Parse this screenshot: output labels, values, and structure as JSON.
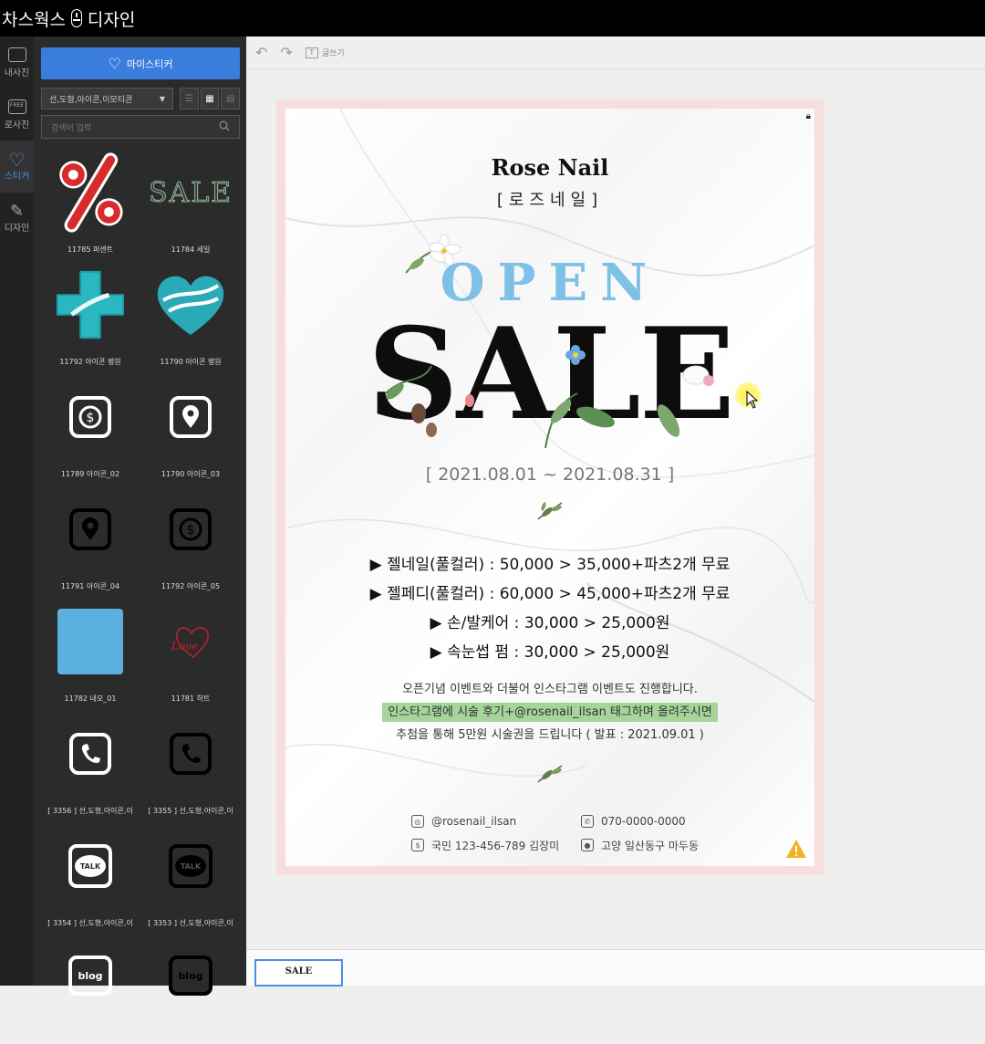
{
  "app": {
    "title_left": "차스웍스",
    "title_right": "디자인"
  },
  "rail": [
    {
      "label": "내사진",
      "icon": "camera-icon"
    },
    {
      "label": "로사진",
      "icon": "free-photo-icon",
      "badge": "FREE"
    },
    {
      "label": "스티커",
      "icon": "heart-icon",
      "active": true
    },
    {
      "label": "디자인",
      "icon": "pencil-icon"
    }
  ],
  "panel": {
    "sticker_button": "마이스티커",
    "category": "선,도형,아이콘,이모티콘",
    "search_placeholder": "검색어 입력",
    "stickers": [
      {
        "caption": "11785 퍼센트",
        "icon": "percent-icon"
      },
      {
        "caption": "11784 세일",
        "icon": "sale-text-icon",
        "text": "SALE"
      },
      {
        "caption": "11792 아이콘 병원",
        "icon": "medical-cross-icon"
      },
      {
        "caption": "11790 아이콘 병원",
        "icon": "heart-icon"
      },
      {
        "caption": "11789 아이콘_02",
        "icon": "dollar-icon"
      },
      {
        "caption": "11790 아이콘_03",
        "icon": "location-pin-icon"
      },
      {
        "caption": "11791 아이콘_04",
        "icon": "location-pin-icon"
      },
      {
        "caption": "11792 아이콘_05",
        "icon": "dollar-icon"
      },
      {
        "caption": "11782 네모_01",
        "icon": "square-icon"
      },
      {
        "caption": "11781 하트",
        "icon": "love-scribble-icon"
      },
      {
        "caption": "[ 3356 ] 선,도형,아이콘,이",
        "icon": "phone-icon"
      },
      {
        "caption": "[ 3355 ] 선,도형,아이콘,이",
        "icon": "phone-icon"
      },
      {
        "caption": "[ 3354 ] 선,도형,아이콘,이",
        "icon": "talk-bubble-icon",
        "text": "TALK"
      },
      {
        "caption": "[ 3353 ] 선,도형,아이콘,이",
        "icon": "talk-bubble-icon",
        "text": "TALK"
      },
      {
        "caption": "",
        "icon": "blog-icon",
        "text": "blog"
      },
      {
        "caption": "",
        "icon": "blog-icon",
        "text": "blog"
      }
    ]
  },
  "toolbar": {
    "text_tool": "글쓰기"
  },
  "poster": {
    "brand": "Rose Nail",
    "brand_sub": "[로즈네일]",
    "open": "OPEN",
    "sale": "SALE",
    "dates": "[ 2021.08.01 ~ 2021.08.31 ]",
    "items": [
      "▶ 젤네일(풀컬러) : 50,000 > 35,000+파츠2개 무료",
      "▶ 젤페디(풀컬러) : 60,000 > 45,000+파츠2개 무료",
      "▶ 손/발케어 : 30,000 > 25,000원",
      "▶ 속눈썹 펌 : 30,000 > 25,000원"
    ],
    "notice": [
      "오픈기념 이벤트와 더불어 인스타그램 이벤트도 진행합니다.",
      "인스타그램에 시술 후기+@rosenail_ilsan 태그하며 올려주시면",
      "추첨을 통해 5만원 시술권을 드립니다 ( 발표 : 2021.09.01 )"
    ],
    "contacts": {
      "instagram": "@rosenail_ilsan",
      "phone": "070-0000-0000",
      "account": "국민 123-456-789 김장미",
      "address": "고양 일산동구 마두동"
    },
    "colors": {
      "open": "#7ec0e6",
      "highlight": "#a6d59a",
      "border": "#f7dede"
    }
  },
  "filmstrip": {
    "thumb_label": "SALE"
  }
}
